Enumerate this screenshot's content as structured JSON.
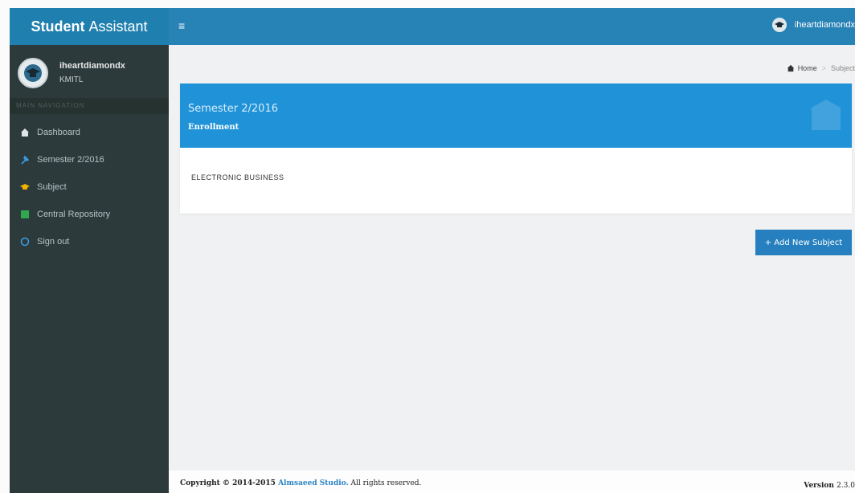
{
  "brand": {
    "bold": "Student",
    "rest": "Assistant"
  },
  "user": {
    "name": "iheartdiamondx",
    "org": "KMITL"
  },
  "nav_header": "MAIN NAVIGATION",
  "nav": [
    {
      "label": "Dashboard",
      "icon": "dashboard-icon"
    },
    {
      "label": "Semester 2/2016",
      "icon": "pin-icon"
    },
    {
      "label": "Subject",
      "icon": "graduation-icon"
    },
    {
      "label": "Central Repository",
      "icon": "square-icon"
    },
    {
      "label": "Sign out",
      "icon": "circle-icon"
    }
  ],
  "topbar": {
    "menu_glyph": "≡",
    "user": "iheartdiamondx"
  },
  "breadcrumb": {
    "home": "Home",
    "sep": ">",
    "current": "Subject"
  },
  "box": {
    "title": "Semester 2/2016",
    "subtitle": "Enrollment",
    "subject": "ELECTRONIC BUSINESS"
  },
  "add_button": "+ Add New Subject",
  "footer": {
    "copy_prefix": "Copyright © 2014-2015 ",
    "link": "Almsaeed Studio.",
    "copy_suffix": " All rights reserved.",
    "version_label": "Version ",
    "version": "2.3.0"
  },
  "colors": {
    "brand": "#1f7fae",
    "topbar": "#2782b6",
    "sidebar": "#2d3a3c",
    "box_header": "#1f92d8",
    "button": "#2680bf"
  }
}
